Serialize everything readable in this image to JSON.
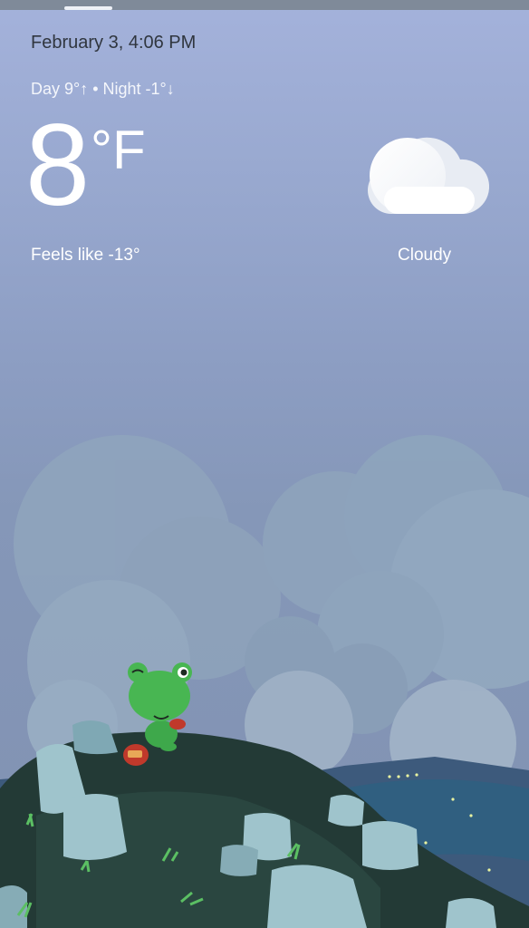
{
  "header": {
    "datetime": "February 3, 4:06 PM",
    "day_night": "Day 9°↑ • Night -1°↓"
  },
  "current": {
    "temperature": "8",
    "unit": "°F",
    "feels_like": "Feels like -13°",
    "condition": "Cloudy",
    "condition_icon": "cloud-icon"
  },
  "scene": {
    "character": "frog-illustration"
  },
  "colors": {
    "sky_top": "#a4b2db",
    "sky_bottom": "#8192b2",
    "frog": "#4caf50",
    "rocks": "#9fc4cc"
  }
}
